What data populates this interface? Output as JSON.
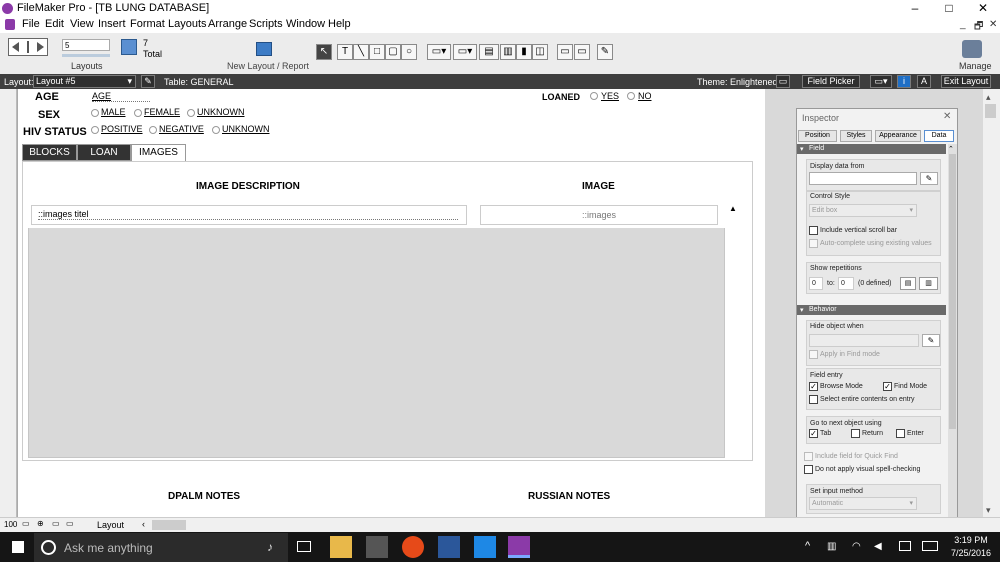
{
  "window": {
    "title": "FileMaker Pro - [TB LUNG DATABASE]",
    "minimize": "–",
    "maximize": "□",
    "close": "✕",
    "mdi_min": "_",
    "mdi_restore": "🗗",
    "mdi_close": "✕"
  },
  "menu": [
    "File",
    "Edit",
    "View",
    "Insert",
    "Format",
    "Layouts",
    "Arrange",
    "Scripts",
    "Window",
    "Help"
  ],
  "toolbar": {
    "record_number": "5",
    "total_count": "7",
    "total_label": "Total",
    "layouts_label": "Layouts",
    "new_layout_label": "New Layout / Report",
    "manage_label": "Manage"
  },
  "layoutbar": {
    "layout_label": "Layout:",
    "layout_value": "Layout #5",
    "table_label": "Table: GENERAL",
    "theme_label": "Theme: Enlightened",
    "field_picker": "Field Picker",
    "exit_layout": "Exit Layout",
    "aa": "A"
  },
  "form": {
    "age_label": "AGE",
    "age_field": "AGE",
    "sex_label": "SEX",
    "sex_options": [
      "MALE",
      "FEMALE",
      "UNKNOWN"
    ],
    "hiv_label": "HIV STATUS",
    "hiv_options": [
      "POSITIVE",
      "NEGATIVE",
      "UNKNOWN"
    ],
    "loaned_label": "LOANED",
    "loaned_options": [
      "YES",
      "NO"
    ],
    "tabs": [
      "BLOCKS",
      "LOAN",
      "IMAGES"
    ],
    "image_desc_header": "IMAGE DESCRIPTION",
    "image_header": "IMAGE",
    "images_title_field": "::images titel",
    "images_field": "::images",
    "dpalm_notes": "DPALM NOTES",
    "russian_notes": "RUSSIAN NOTES"
  },
  "inspector": {
    "title": "Inspector",
    "tabs": [
      "Position",
      "Styles",
      "Appearance",
      "Data"
    ],
    "field_section": "Field",
    "display_data_from": "Display data from",
    "control_style": "Control Style",
    "edit_box": "Edit box",
    "include_vscroll": "Include vertical scroll bar",
    "auto_complete": "Auto-complete using existing values",
    "show_repetitions": "Show repetitions",
    "rep_from": "0",
    "rep_to_label": "to:",
    "rep_to": "0",
    "rep_defined": "(0 defined)",
    "behavior_section": "Behavior",
    "hide_object_when": "Hide object when",
    "apply_in_find": "Apply in Find mode",
    "field_entry": "Field entry",
    "browse_mode": "Browse Mode",
    "find_mode": "Find Mode",
    "select_entire": "Select entire contents on entry",
    "go_next_object": "Go to next object using",
    "tab_key": "Tab",
    "return_key": "Return",
    "enter_key": "Enter",
    "include_quick_find": "Include field for Quick Find",
    "no_spellcheck": "Do not apply visual spell-checking",
    "set_input_method": "Set input method",
    "automatic": "Automatic"
  },
  "statusbar": {
    "zoom": "100",
    "mode": "Layout"
  },
  "taskbar": {
    "search_placeholder": "Ask me anything",
    "time": "3:19 PM",
    "date": "7/25/2016"
  }
}
